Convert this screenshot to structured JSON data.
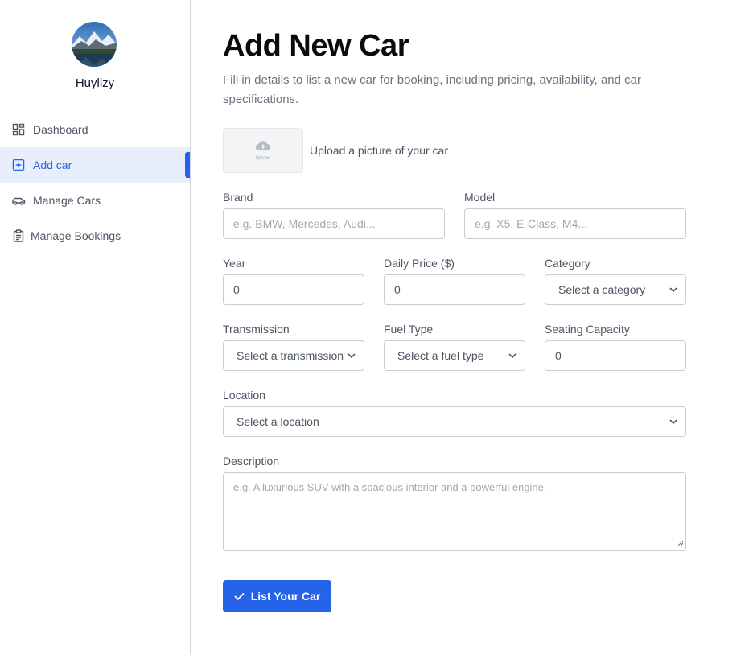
{
  "sidebar": {
    "username": "Huyllzy",
    "items": [
      {
        "label": "Dashboard",
        "icon": "dashboard-icon"
      },
      {
        "label": "Add car",
        "icon": "plus-square-icon",
        "active": true
      },
      {
        "label": "Manage Cars",
        "icon": "car-icon"
      },
      {
        "label": "Manage Bookings",
        "icon": "clipboard-icon"
      }
    ]
  },
  "page": {
    "title": "Add New Car",
    "subtitle": "Fill in details to list a new car for booking, including pricing, availability, and car specifications."
  },
  "upload": {
    "box_text": "Upload",
    "label": "Upload a picture of your car"
  },
  "form": {
    "brand": {
      "label": "Brand",
      "placeholder": "e.g. BMW, Mercedes, Audi..."
    },
    "model": {
      "label": "Model",
      "placeholder": "e.g. X5, E-Class, M4..."
    },
    "year": {
      "label": "Year",
      "value": "0"
    },
    "daily_price": {
      "label": "Daily Price ($)",
      "value": "0"
    },
    "category": {
      "label": "Category",
      "selected": "Select a category"
    },
    "transmission": {
      "label": "Transmission",
      "selected": "Select a transmission"
    },
    "fuel_type": {
      "label": "Fuel Type",
      "selected": "Select a fuel type"
    },
    "seating_capacity": {
      "label": "Seating Capacity",
      "value": "0"
    },
    "location": {
      "label": "Location",
      "selected": "Select a location"
    },
    "description": {
      "label": "Description",
      "placeholder": "e.g. A luxurious SUV with a spacious interior and a powerful engine."
    },
    "submit_label": "List Your Car"
  },
  "colors": {
    "accent": "#2563eb",
    "active_bg": "#e8eefc",
    "border": "#c9cdd3"
  }
}
